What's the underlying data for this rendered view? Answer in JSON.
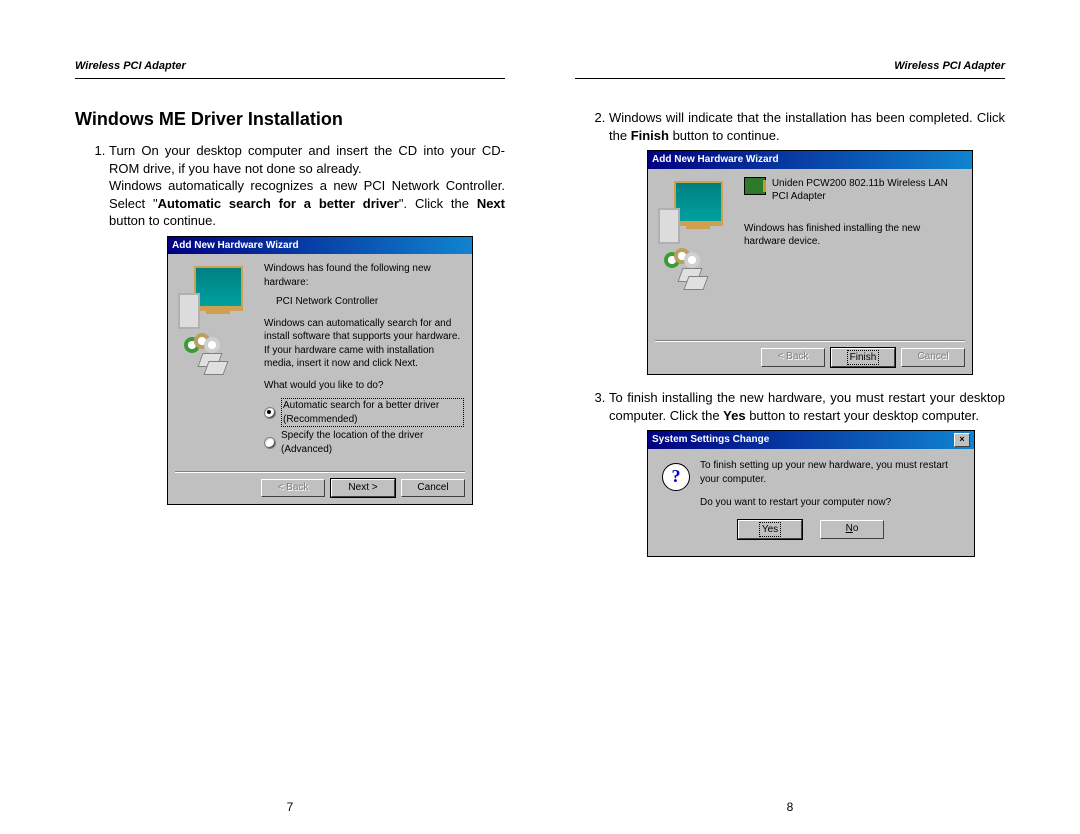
{
  "header": "Wireless  PCI  Adapter",
  "heading": "Windows ME Driver Installation",
  "page_left_num": "7",
  "page_right_num": "8",
  "step1": {
    "line1": "Turn On your desktop computer and insert the CD into your CD-ROM drive, if you have not done so already.",
    "line2_a": "Windows automatically recognizes a new PCI Network Controller.    Select  \"",
    "line2_bold": "Automatic  search  for  a  better driver",
    "line2_b": "\".    Click the ",
    "line2_bold2": "Next",
    "line2_c": " button to continue."
  },
  "step2": {
    "text_a": "Windows  will  indicate  that  the  installation  has  been completed.    Click the ",
    "text_bold": "Finish",
    "text_b": " button to continue."
  },
  "step3": {
    "text_a": "To finish installing the new hardware, you must restart your desktop  computer.    Click  the  ",
    "text_bold": "Yes",
    "text_b": "  button  to  restart  your desktop computer."
  },
  "dlg1": {
    "title": "Add New Hardware Wizard",
    "found": "Windows has found the following new hardware:",
    "device": "PCI Network Controller",
    "desc": "Windows can automatically search for and install software that supports your hardware. If your hardware came with installation media, insert it now and click Next.",
    "prompt": "What would you like to do?",
    "opt1": "Automatic search for a better driver (Recommended)",
    "opt2": "Specify the location of the driver (Advanced)",
    "back": "< Back",
    "next": "Next >",
    "cancel": "Cancel"
  },
  "dlg2": {
    "title": "Add New Hardware Wizard",
    "device": "Uniden PCW200 802.11b Wireless LAN PCI Adapter",
    "finished": "Windows has finished installing the new hardware device.",
    "back": "< Back",
    "finish": "Finish",
    "cancel": "Cancel"
  },
  "dlg3": {
    "title": "System Settings Change",
    "line1": "To finish setting up your new hardware, you must restart your computer.",
    "line2": "Do you want to restart your computer now?",
    "yes": "Yes",
    "no": "No",
    "close": "×"
  }
}
